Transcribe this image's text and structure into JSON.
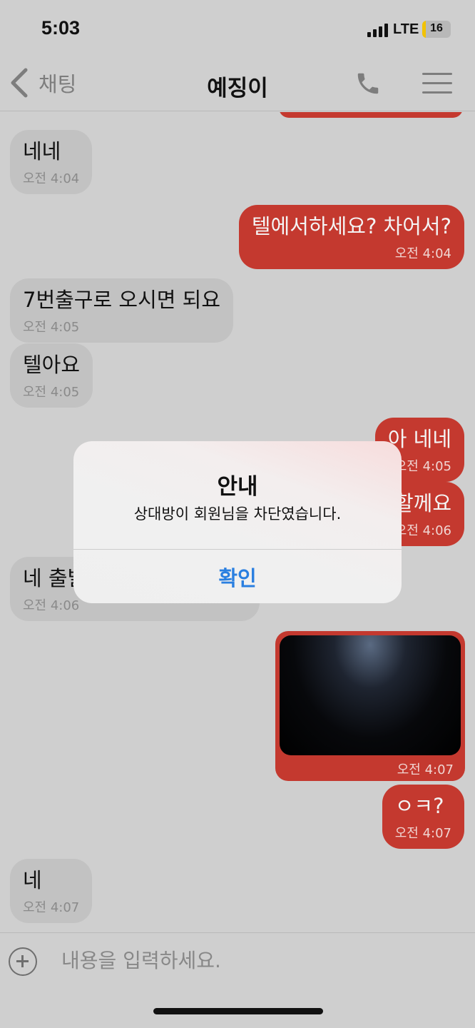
{
  "status_bar": {
    "time": "5:03",
    "network": "LTE",
    "battery": "16",
    "battery_color": "#f2c200"
  },
  "nav": {
    "back_label": "채팅",
    "title": "예징이",
    "call_icon": "phone-icon",
    "menu_icon": "hamburger-menu-icon"
  },
  "colors": {
    "outgoing_bubble": "#c4392f",
    "incoming_bubble": "#c2c2c2",
    "background": "#cfcfcf",
    "alert_button": "#2a7fe0"
  },
  "messages": [
    {
      "direction": "in",
      "text": "네네",
      "time": "오전 4:04"
    },
    {
      "direction": "out",
      "text": "텔에서하세요? 차어서?",
      "time": "오전 4:04"
    },
    {
      "direction": "in",
      "text": "7번출구로 오시면 되요",
      "time": "오전 4:05"
    },
    {
      "direction": "in",
      "text": "텔아요",
      "time": "오전 4:05"
    },
    {
      "direction": "out",
      "text": "아 네네",
      "time": "오전 4:05"
    },
    {
      "direction": "out",
      "text": "할께요",
      "time": "오전 4:06"
    },
    {
      "direction": "in",
      "text": "네 출발",
      "time": "오전 4:06"
    },
    {
      "direction": "out",
      "type": "image",
      "time": "오전 4:07"
    },
    {
      "direction": "out",
      "text": "ㅇㅋ?",
      "time": "오전 4:07"
    },
    {
      "direction": "in",
      "text": "네",
      "time": "오전 4:07"
    }
  ],
  "input": {
    "placeholder": "내용을 입력하세요."
  },
  "alert": {
    "title": "안내",
    "message": "상대방이 회원님을 차단였습니다.",
    "confirm_label": "확인"
  }
}
